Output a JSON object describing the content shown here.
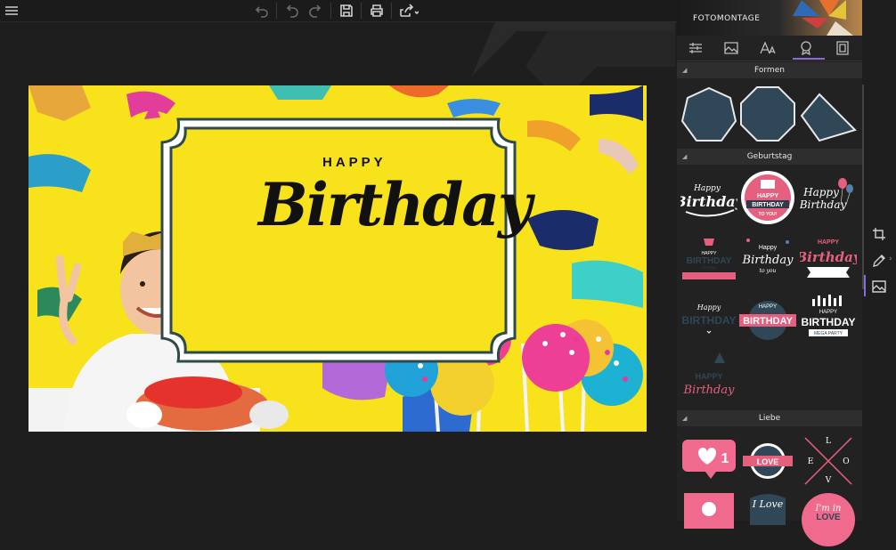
{
  "toolbar": {
    "menu_icon": "hamburger-icon",
    "undo_icon": "undo-icon",
    "undo2_icon": "undo-step-icon",
    "redo_icon": "redo-icon",
    "save_icon": "floppy-disk-icon",
    "print_icon": "printer-icon",
    "share_icon": "share-icon"
  },
  "canvas": {
    "sticker_text_top": "HAPPY",
    "sticker_text_main": "Birthday"
  },
  "panel": {
    "title": "FOTOMONTAGE",
    "tabs": [
      {
        "icon": "sliders-icon"
      },
      {
        "icon": "image-icon"
      },
      {
        "icon": "text-icon"
      },
      {
        "icon": "badge-icon",
        "active": true
      },
      {
        "icon": "frame-icon"
      }
    ],
    "sections": {
      "shapes": "Formen",
      "birthday": "Geburtstag",
      "love": "Liebe"
    },
    "stickers": {
      "b1": {
        "line1": "Happy",
        "line2": "Birthday"
      },
      "b2": {
        "line1": "HAPPY",
        "line2": "BIRTHDAY",
        "line3": "TO YOU!"
      },
      "b3": {
        "line1": "Happy",
        "line2": "Birthday"
      },
      "b4": {
        "line1": "HAPPY",
        "line2": "BIRTHDAY",
        "line3": "TO YOU!"
      },
      "b5": {
        "line1": "Happy",
        "line2": "Birthday",
        "line3": "to you"
      },
      "b6": {
        "line1": "HAPPY",
        "line2": "Birthday"
      },
      "b7": {
        "line1": "Happy",
        "line2": "BIRTHDAY"
      },
      "b8": {
        "line1": "HAPPY",
        "line2": "BIRTHDAY"
      },
      "b9": {
        "line1": "HAPPY",
        "line2": "BIRTHDAY",
        "line3": "MEGA PARTY"
      },
      "b10": {
        "line1": "HAPPY",
        "line2": "Birthday"
      },
      "l1": {
        "count": "1"
      },
      "l2": {
        "text": "LOVE"
      },
      "l3": {
        "l": "L",
        "o": "O",
        "v": "V",
        "e": "E"
      },
      "l5": {
        "text": "I Love"
      },
      "l6": {
        "line1": "I'm in",
        "line2": "LOVE"
      }
    }
  },
  "sidetools": [
    "crop-icon",
    "pencil-icon",
    "photo-icon"
  ]
}
